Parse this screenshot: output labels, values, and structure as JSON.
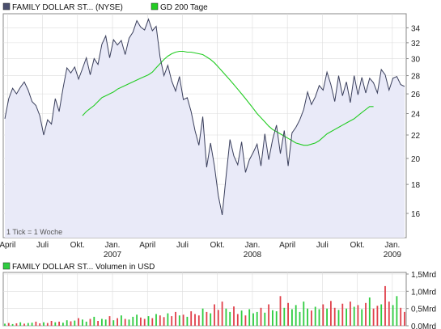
{
  "legend": {
    "price_label": "FAMILY DOLLAR ST... (NYSE)",
    "ma_label": "GD 200 Tage",
    "volume_label": "FAMILY DOLLAR ST... Volumen in USD",
    "colors": {
      "price_swatch": "#4a4f6e",
      "ma": "#22cc22",
      "vol_swatch": "#2ecc40"
    }
  },
  "note": "1 Tick = 1 Woche",
  "chart_data": [
    {
      "type": "line",
      "y_scale": "log",
      "ylim": [
        14.5,
        36
      ],
      "y_ticks": [
        "34",
        "32",
        "30",
        "28",
        "26",
        "24",
        "22",
        "20",
        "18",
        "16"
      ],
      "x_ticks": [
        "April",
        "Juli",
        "Okt.",
        "Jan.",
        "April",
        "Juli",
        "Okt.",
        "Jan.",
        "April",
        "Juli",
        "Okt.",
        "Jan."
      ],
      "x_year_labels": [
        "2007",
        "2008",
        "2009"
      ],
      "x_weeks": 104,
      "series": [
        {
          "name": "FAMILY DOLLAR ST... (NYSE)",
          "color": "#3a3f5c",
          "fill": "#e8e9f7",
          "values": [
            23.5,
            25.5,
            26.6,
            26.0,
            26.7,
            27.3,
            26.4,
            25.2,
            24.8,
            23.8,
            22.0,
            23.4,
            23.0,
            25.5,
            24.2,
            26.6,
            28.9,
            28.3,
            29.0,
            27.6,
            28.8,
            30.1,
            28.1,
            30.0,
            29.3,
            31.8,
            32.9,
            30.1,
            32.4,
            31.7,
            32.3,
            30.5,
            32.6,
            33.4,
            35.0,
            34.1,
            33.7,
            35.2,
            33.6,
            34.2,
            30.2,
            28.0,
            29.2,
            27.4,
            26.3,
            27.9,
            25.4,
            25.6,
            24.2,
            22.4,
            21.1,
            23.7,
            19.3,
            21.3,
            19.4,
            17.2,
            15.9,
            18.6,
            21.6,
            20.2,
            19.5,
            21.4,
            18.9,
            19.9,
            20.5,
            21.2,
            19.4,
            22.1,
            19.9,
            21.6,
            22.9,
            20.4,
            22.4,
            19.4,
            22.2,
            22.7,
            23.4,
            24.4,
            26.2,
            24.9,
            25.7,
            26.9,
            26.4,
            28.4,
            27.0,
            25.2,
            28.0,
            25.8,
            27.3,
            25.1,
            28.0,
            25.9,
            27.8,
            26.1,
            27.7,
            27.2,
            26.1,
            28.7,
            28.1,
            26.4,
            27.7,
            27.9,
            27.0,
            26.8
          ]
        },
        {
          "name": "GD 200 Tage",
          "color": "#22cc22",
          "start_index": 20,
          "values": [
            23.8,
            24.2,
            24.5,
            24.8,
            25.2,
            25.6,
            25.8,
            26.0,
            26.2,
            26.5,
            26.7,
            26.9,
            27.1,
            27.3,
            27.5,
            27.7,
            27.9,
            28.1,
            28.4,
            28.9,
            29.4,
            29.9,
            30.3,
            30.6,
            30.8,
            30.9,
            30.9,
            30.8,
            30.8,
            30.7,
            30.6,
            30.5,
            30.2,
            29.9,
            29.5,
            29.0,
            28.5,
            28.0,
            27.5,
            27.0,
            26.5,
            26.0,
            25.5,
            25.0,
            24.5,
            24.0,
            23.6,
            23.2,
            22.8,
            22.5,
            22.3,
            22.1,
            21.9,
            21.7,
            21.5,
            21.3,
            21.2,
            21.1,
            21.1,
            21.2,
            21.3,
            21.5,
            21.8,
            22.1,
            22.3,
            22.5,
            22.7,
            22.9,
            23.1,
            23.3,
            23.5,
            23.8,
            24.1,
            24.4,
            24.7,
            24.7
          ]
        }
      ]
    },
    {
      "type": "bar",
      "title": "FAMILY DOLLAR ST... Volumen in USD",
      "ylim": [
        0,
        1.5
      ],
      "y_ticks": [
        "1,5Mrd",
        "1,0Mrd",
        "0,5Mrd",
        "0,0Mrd"
      ],
      "unit": "Mrd USD",
      "colors": {
        "up": "#2ecc40",
        "down": "#e0404a"
      },
      "values": [
        0.06,
        0.08,
        0.05,
        0.07,
        0.1,
        0.06,
        0.08,
        0.09,
        0.12,
        0.07,
        0.1,
        0.08,
        0.14,
        0.1,
        0.12,
        0.09,
        0.16,
        0.13,
        0.15,
        0.22,
        0.18,
        0.12,
        0.2,
        0.26,
        0.14,
        0.2,
        0.18,
        0.28,
        0.16,
        0.22,
        0.3,
        0.2,
        0.18,
        0.26,
        0.32,
        0.24,
        0.2,
        0.28,
        0.22,
        0.34,
        0.3,
        0.25,
        0.36,
        0.28,
        0.4,
        0.3,
        0.32,
        0.26,
        0.42,
        0.34,
        0.3,
        0.5,
        0.4,
        0.36,
        0.62,
        0.46,
        0.7,
        0.5,
        0.4,
        0.56,
        0.34,
        0.44,
        0.3,
        0.48,
        0.36,
        0.4,
        0.52,
        0.38,
        0.62,
        0.45,
        0.42,
        0.86,
        0.52,
        0.66,
        0.48,
        0.6,
        0.4,
        0.7,
        0.5,
        0.44,
        0.55,
        0.48,
        0.62,
        0.5,
        0.72,
        0.52,
        0.46,
        0.64,
        0.5,
        0.7,
        0.55,
        0.6,
        0.48,
        0.66,
        0.82,
        0.5,
        0.58,
        0.62,
        1.15,
        0.7,
        0.6,
        0.86,
        0.52,
        0.4
      ],
      "up": [
        1,
        0,
        1,
        0,
        1,
        0,
        1,
        1,
        0,
        0,
        1,
        0,
        0,
        1,
        0,
        1,
        1,
        0,
        1,
        0,
        1,
        1,
        0,
        1,
        0,
        1,
        1,
        0,
        1,
        0,
        1,
        0,
        1,
        1,
        1,
        0,
        0,
        1,
        0,
        1,
        0,
        0,
        1,
        0,
        0,
        1,
        0,
        1,
        0,
        0,
        0,
        1,
        0,
        1,
        0,
        0,
        0,
        1,
        1,
        0,
        0,
        1,
        0,
        1,
        1,
        1,
        0,
        1,
        0,
        1,
        1,
        0,
        1,
        0,
        1,
        1,
        1,
        1,
        1,
        0,
        1,
        1,
        0,
        1,
        0,
        0,
        1,
        0,
        1,
        0,
        1,
        0,
        1,
        0,
        1,
        0,
        0,
        1,
        0,
        0,
        1,
        1,
        0,
        0
      ]
    }
  ]
}
